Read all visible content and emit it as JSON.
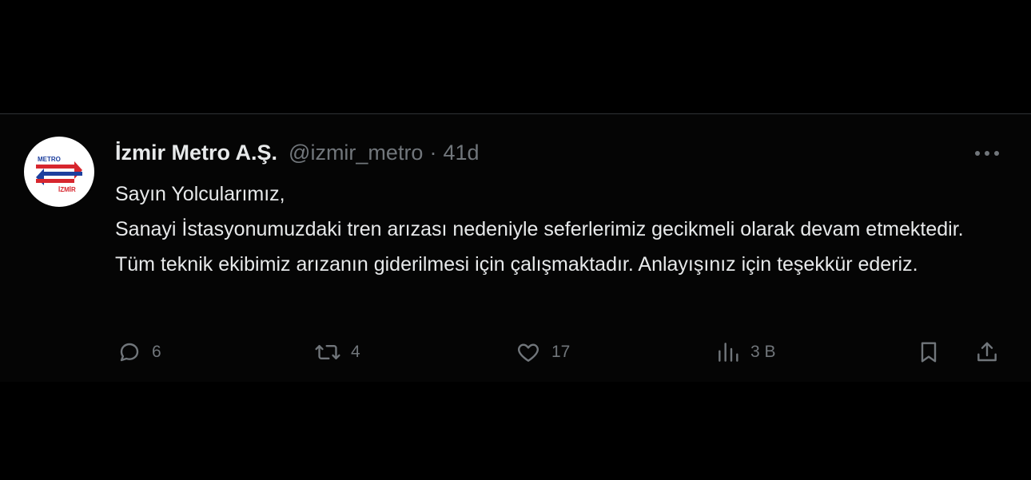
{
  "tweet": {
    "author": {
      "display_name": "İzmir Metro A.Ş.",
      "handle": "@izmir_metro",
      "separator": "·",
      "time": "41d",
      "avatar_logo": {
        "top_text": "METRO",
        "bottom_text": "İZMİR",
        "colors": {
          "red": "#d7262e",
          "blue": "#1d3f9e"
        }
      }
    },
    "text_lines": [
      "Sayın Yolcularımız,",
      "Sanayi İstasyonumuzdaki tren arızası nedeniyle seferlerimiz gecikmeli olarak devam etmektedir. Tüm teknik ekibimiz arızanın giderilmesi için çalışmaktadır. Anlayışınız için teşekkür ederiz."
    ],
    "actions": {
      "reply": {
        "icon": "reply-icon",
        "count": "6"
      },
      "repost": {
        "icon": "repost-icon",
        "count": "4"
      },
      "like": {
        "icon": "heart-icon",
        "count": "17"
      },
      "views": {
        "icon": "views-icon",
        "count": "3 B"
      },
      "bookmark": {
        "icon": "bookmark-icon"
      },
      "share": {
        "icon": "share-icon"
      }
    },
    "more_icon": "more-horizontal-icon"
  },
  "colors": {
    "background": "#000000",
    "text_primary": "#e7e9ea",
    "text_secondary": "#71767b",
    "divider": "#2f3336"
  }
}
